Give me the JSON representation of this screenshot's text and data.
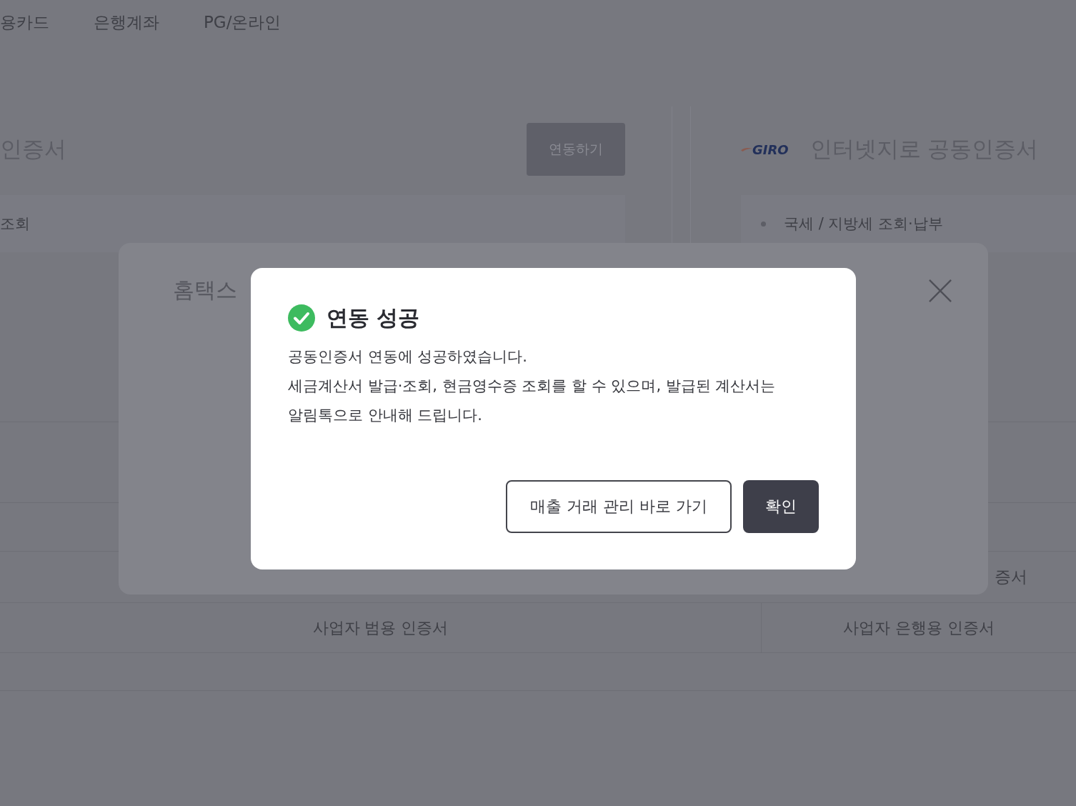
{
  "background": {
    "tabs": [
      {
        "label": "용카드",
        "selected": false
      },
      {
        "label": "은행계좌",
        "selected": false
      },
      {
        "label": "PG/온라인",
        "selected": false
      }
    ],
    "left_panel": {
      "title": "인증서",
      "connect_button": "연동하기",
      "list_item": "조회",
      "certificate_type": "사업자 범용 인증서"
    },
    "right_panel": {
      "logo": "GIRO",
      "title": "인터넷지로 공동인증서",
      "list_item": "국세 / 지방세 조회·납부",
      "row_text": "증서",
      "certificate_type": "사업자 은행용 인증서"
    }
  },
  "hometax_modal": {
    "title": "홈택스"
  },
  "success_dialog": {
    "title": "연동 성공",
    "message_lines": [
      "공동인증서 연동에 성공하였습니다.",
      "세금계산서 발급·조회, 현금영수증 조회를 할 수 있으며, 발급된 계산서는",
      "알림톡으로 안내해 드립니다."
    ],
    "buttons": [
      {
        "kind": "secondary",
        "label": "매출 거래 관리 바로 가기"
      },
      {
        "kind": "primary",
        "label": "확인"
      }
    ]
  }
}
